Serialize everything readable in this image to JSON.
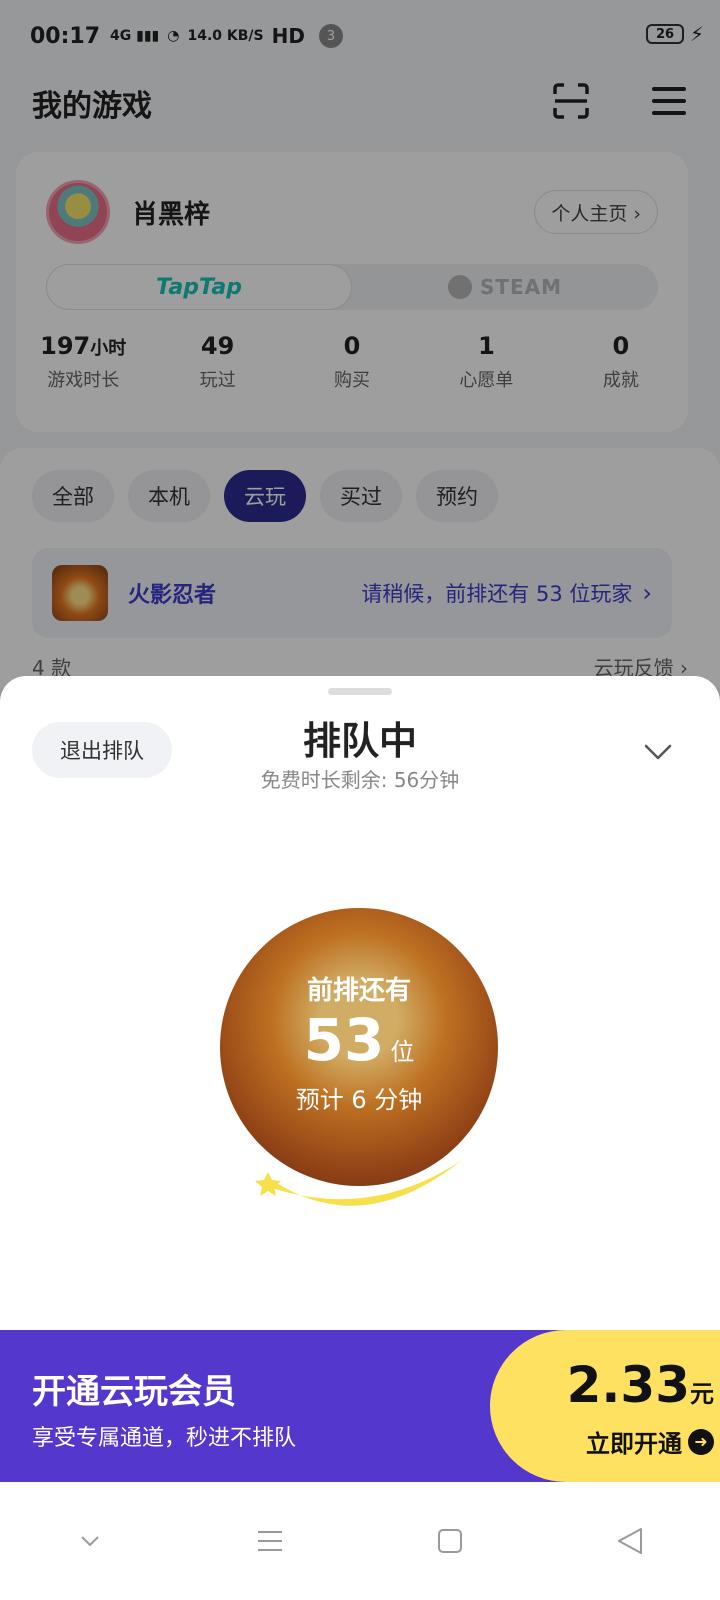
{
  "status_bar": {
    "time": "00:17",
    "network": "4G",
    "speed": "14.0",
    "speed_unit": "KB/S",
    "hd": "HD",
    "notif_count": "3",
    "battery": "26"
  },
  "header": {
    "title": "我的游戏"
  },
  "profile": {
    "name": "肖黑梓",
    "homepage_label": "个人主页 ›",
    "platforms": {
      "active": "TapTap",
      "inactive": "STEAM"
    },
    "stats": [
      {
        "value": "197",
        "unit": "小时",
        "label": "游戏时长"
      },
      {
        "value": "49",
        "unit": "",
        "label": "玩过"
      },
      {
        "value": "0",
        "unit": "",
        "label": "购买"
      },
      {
        "value": "1",
        "unit": "",
        "label": "心愿单"
      },
      {
        "value": "0",
        "unit": "",
        "label": "成就"
      }
    ]
  },
  "filters": {
    "chips": [
      "全部",
      "本机",
      "云玩",
      "买过",
      "预约"
    ],
    "active": "云玩"
  },
  "game": {
    "name": "火影忍者",
    "queue_message": "请稍候，前排还有 53 位玩家"
  },
  "list_footer": {
    "count": "4 款",
    "feedback": "云玩反馈 ›"
  },
  "sheet": {
    "exit_label": "退出排队",
    "title": "排队中",
    "free_time": "免费时长剩余: 56分钟",
    "ahead_label": "前排还有",
    "position": "53",
    "position_unit": "位",
    "eta": "预计 6 分钟"
  },
  "vip": {
    "title": "开通云玩会员",
    "subtitle": "享受专属通道，秒进不排队",
    "price": "2.33",
    "price_unit": "元",
    "cta": "立即开通"
  },
  "colors": {
    "accent": "#2b2d8f",
    "link": "#3a3cc9",
    "vip_bg": "#5437cc",
    "vip_cta": "#ffe161"
  }
}
